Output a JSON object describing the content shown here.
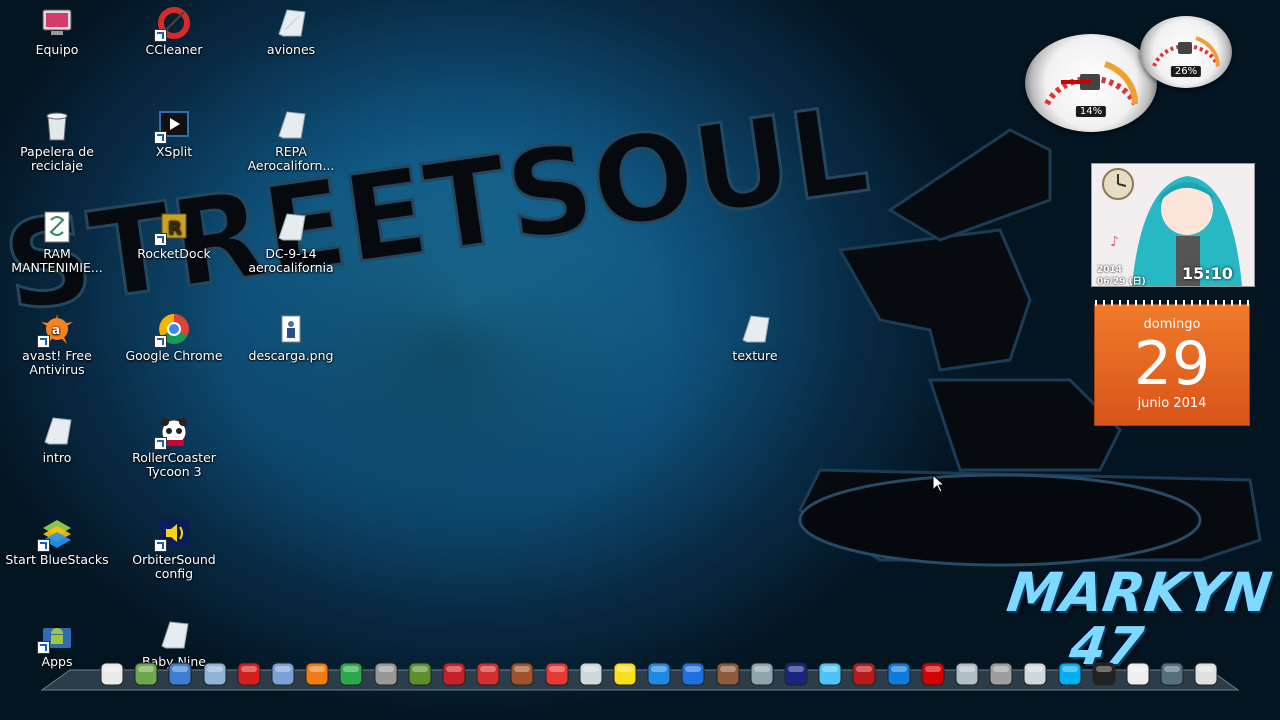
{
  "desktop": {
    "wallpaper_text": "STREETSOUL",
    "watermark_line1": "MARKYN",
    "watermark_line2": "47",
    "icons": [
      {
        "label": "Equipo",
        "icon": "computer-icon"
      },
      {
        "label": "CCleaner",
        "icon": "ccleaner-icon"
      },
      {
        "label": "aviones",
        "icon": "file-icon"
      },
      {
        "label": "Papelera de reciclaje",
        "icon": "recycle-bin-icon"
      },
      {
        "label": "XSplit",
        "icon": "xsplit-icon"
      },
      {
        "label": "REPA Aerocaliforn...",
        "icon": "file-icon"
      },
      {
        "label": "RAM MANTENIMIE...",
        "icon": "script-icon"
      },
      {
        "label": "RocketDock",
        "icon": "rocketdock-icon"
      },
      {
        "label": "DC-9-14 aerocalifornia",
        "icon": "file-icon"
      },
      {
        "label": "avast! Free Antivirus",
        "icon": "avast-icon"
      },
      {
        "label": "Google Chrome",
        "icon": "chrome-icon"
      },
      {
        "label": "descarga.png",
        "icon": "image-file-icon"
      },
      {
        "label": "texture",
        "icon": "file-icon"
      },
      {
        "label": "intro",
        "icon": "file-icon"
      },
      {
        "label": "RollerCoaster Tycoon 3",
        "icon": "panda-icon"
      },
      {
        "label": "Start BlueStacks",
        "icon": "bluestacks-icon"
      },
      {
        "label": "OrbiterSound config",
        "icon": "speaker-icon"
      },
      {
        "label": "Apps",
        "icon": "android-icon"
      },
      {
        "label": "Baby Nine",
        "icon": "file-icon"
      }
    ]
  },
  "gadgets": {
    "cpu_gauge": {
      "percent_label": "14%",
      "value": 14
    },
    "ram_gauge": {
      "percent_label": "26%",
      "value": 26
    },
    "photo_clock": {
      "date_year": "2014",
      "date": "06/29 (日)",
      "time": "15:10"
    },
    "calendar": {
      "weekday": "domingo",
      "day": "29",
      "month_year": "junio 2014"
    }
  },
  "dock": {
    "items": [
      "notepad-icon",
      "monitor-icon",
      "globe-icon",
      "folder-icon",
      "stop-icon",
      "mail-icon",
      "puzzle-icon",
      "media-player-icon",
      "paperclip-icon",
      "minecraft-icon",
      "plane-icon",
      "bittorrent-icon",
      "character-icon",
      "chrome-icon",
      "camera-icon",
      "close-x-icon",
      "bluestacks-icon",
      "play-icon",
      "character-icon",
      "folder-icon",
      "cinema4d-icon",
      "feather-icon",
      "car-icon",
      "dropbox-icon",
      "flash-icon",
      "scanner-icon",
      "train-icon",
      "tools-icon",
      "skype-icon",
      "tshirt-icon",
      "clipboard-icon",
      "pen-icon",
      "recycle-bin-icon"
    ]
  },
  "colors": {
    "accent": "#1d7fae",
    "calendar": "#e8651f"
  }
}
